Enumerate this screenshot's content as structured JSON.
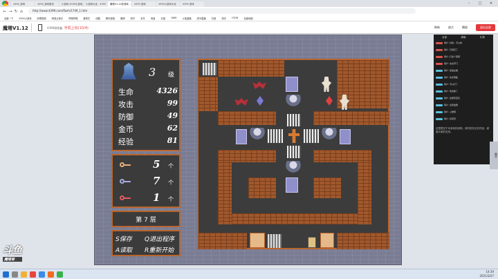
{
  "browser": {
    "tabs": [
      "4399_游戏",
      "4399_游戏首页",
      "小游戏 4399小游戏,小游戏大全",
      "小游戏大全 - 4399",
      "魔塔V1.12在线玩 - 4399",
      "4399 游戏",
      "4399小游戏大全",
      "4399 游戏"
    ],
    "url": "http://www.4399.com/flash/1749_1.htm",
    "bookmarks": [
      "百度一下",
      "4399小游戏",
      "好看视频",
      "网易云音乐",
      "哔哩哔哩",
      "爱奇艺",
      "优酷",
      "腾讯视频",
      "微博",
      "知乎",
      "京东",
      "淘宝",
      "天猫",
      "1688",
      "斗鱼直播",
      "虎牙直播",
      "抖音",
      "快手",
      "CSDN",
      "百度地图"
    ]
  },
  "header": {
    "game_title": "魔塔V1.12",
    "game_line_prefix": "4399游戏盒,",
    "game_line_highlight": "手机上玩(10/4)",
    "buttons": [
      "刷新",
      "放大",
      "播放",
      "退出全屏"
    ]
  },
  "stats": {
    "level": "3",
    "level_unit": "级",
    "rows": [
      {
        "label": "生命",
        "value": "4326"
      },
      {
        "label": "攻击",
        "value": "99"
      },
      {
        "label": "防御",
        "value": "49"
      },
      {
        "label": "金币",
        "value": "62"
      },
      {
        "label": "经验",
        "value": "81"
      }
    ]
  },
  "keys": [
    {
      "color": "#e6b07a",
      "count": "5",
      "unit": "个"
    },
    {
      "color": "#a9a9e3",
      "count": "7",
      "unit": "个"
    },
    {
      "color": "#e55a5a",
      "count": "1",
      "unit": "个"
    }
  ],
  "floor": "第 7 层",
  "help": [
    "S保存",
    "Q退出程序",
    "A读取",
    "R重新开始"
  ],
  "brand": {
    "name": "斗鱼",
    "sub": "魔塔哥"
  },
  "sidebar": {
    "tabs": [
      "全部",
      "弹幕",
      "礼物"
    ],
    "messages": [
      {
        "tag": "#d9534f",
        "text": "用户: 好的，可以的"
      },
      {
        "tag": "#d9534f",
        "text": "用户: 已经买了"
      },
      {
        "tag": "#d9534f",
        "text": "用户: 打这个怪吧"
      },
      {
        "tag": "#d9534f",
        "text": "用户: 先去开门"
      },
      {
        "tag": "#5bc0de",
        "text": "用户: 加油主播"
      },
      {
        "tag": "#5bc0de",
        "text": "用户: 先拿钥匙"
      },
      {
        "tag": "#5bc0de",
        "text": "用户: 可以打了"
      },
      {
        "tag": "#5bc0de",
        "text": "用户: 攻击够了"
      },
      {
        "tag": "#5bc0de",
        "text": "用户: 这层有宝石"
      },
      {
        "tag": "#5bc0de",
        "text": "用户: 注意血量"
      },
      {
        "tag": "#5bc0de",
        "text": "用户: 上楼吧"
      },
      {
        "tag": "#5bc0de",
        "text": "用户: 好厉害"
      }
    ],
    "bottom_text": "这里是关于本游戏的说明，请勿发布无关内容，谢谢大家的支持。",
    "slide_label": "展开"
  },
  "taskbar": {
    "time": "14:39",
    "date": "2021/3/27"
  }
}
